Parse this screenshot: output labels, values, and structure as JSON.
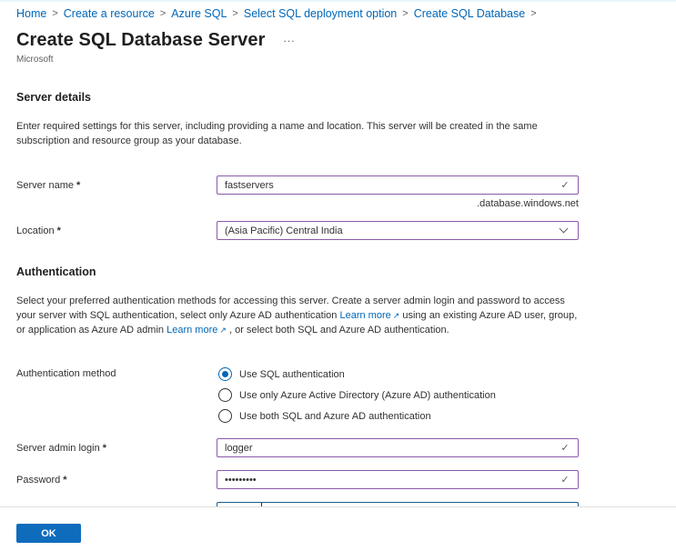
{
  "breadcrumb": [
    {
      "label": "Home"
    },
    {
      "label": "Create a resource"
    },
    {
      "label": "Azure SQL"
    },
    {
      "label": "Select SQL deployment option"
    },
    {
      "label": "Create SQL Database"
    }
  ],
  "breadcrumb_separator": ">",
  "header": {
    "title": "Create SQL Database Server",
    "more_label": "...",
    "publisher": "Microsoft"
  },
  "server_details": {
    "title": "Server details",
    "description": "Enter required settings for this server, including providing a name and location. This server will be created in the same subscription and resource group as your database.",
    "server_name": {
      "label": "Server name",
      "required": "*",
      "value": "fastservers",
      "valid_icon": "✓",
      "suffix": ".database.windows.net"
    },
    "location": {
      "label": "Location",
      "required": "*",
      "value": "(Asia Pacific) Central India"
    }
  },
  "authentication": {
    "title": "Authentication",
    "description_part1": "Select your preferred authentication methods for accessing this server. Create a server admin login and password to access your server with SQL authentication, select only Azure AD authentication ",
    "learn_more_1": "Learn more",
    "description_part2": " using an existing Azure AD user, group, or application as Azure AD admin ",
    "learn_more_2": "Learn more",
    "description_part3": " , or select both SQL and Azure AD authentication.",
    "external_link_icon": "↗",
    "method_label": "Authentication method",
    "options": [
      {
        "label": "Use SQL authentication",
        "checked": true
      },
      {
        "label": "Use only Azure Active Directory (Azure AD) authentication",
        "checked": false
      },
      {
        "label": "Use both SQL and Azure AD authentication",
        "checked": false
      }
    ],
    "admin_login": {
      "label": "Server admin login",
      "required": "*",
      "value": "logger",
      "valid_icon": "✓"
    },
    "password": {
      "label": "Password",
      "required": "*",
      "value": "•••••••••",
      "valid_icon": "✓"
    }
  },
  "footer": {
    "ok_label": "OK"
  },
  "colors": {
    "link": "#0067b8",
    "field_border_valid": "#8a5aa8",
    "primary_button": "#0f6cbd",
    "focused_field_border": "#1b5f8c"
  }
}
